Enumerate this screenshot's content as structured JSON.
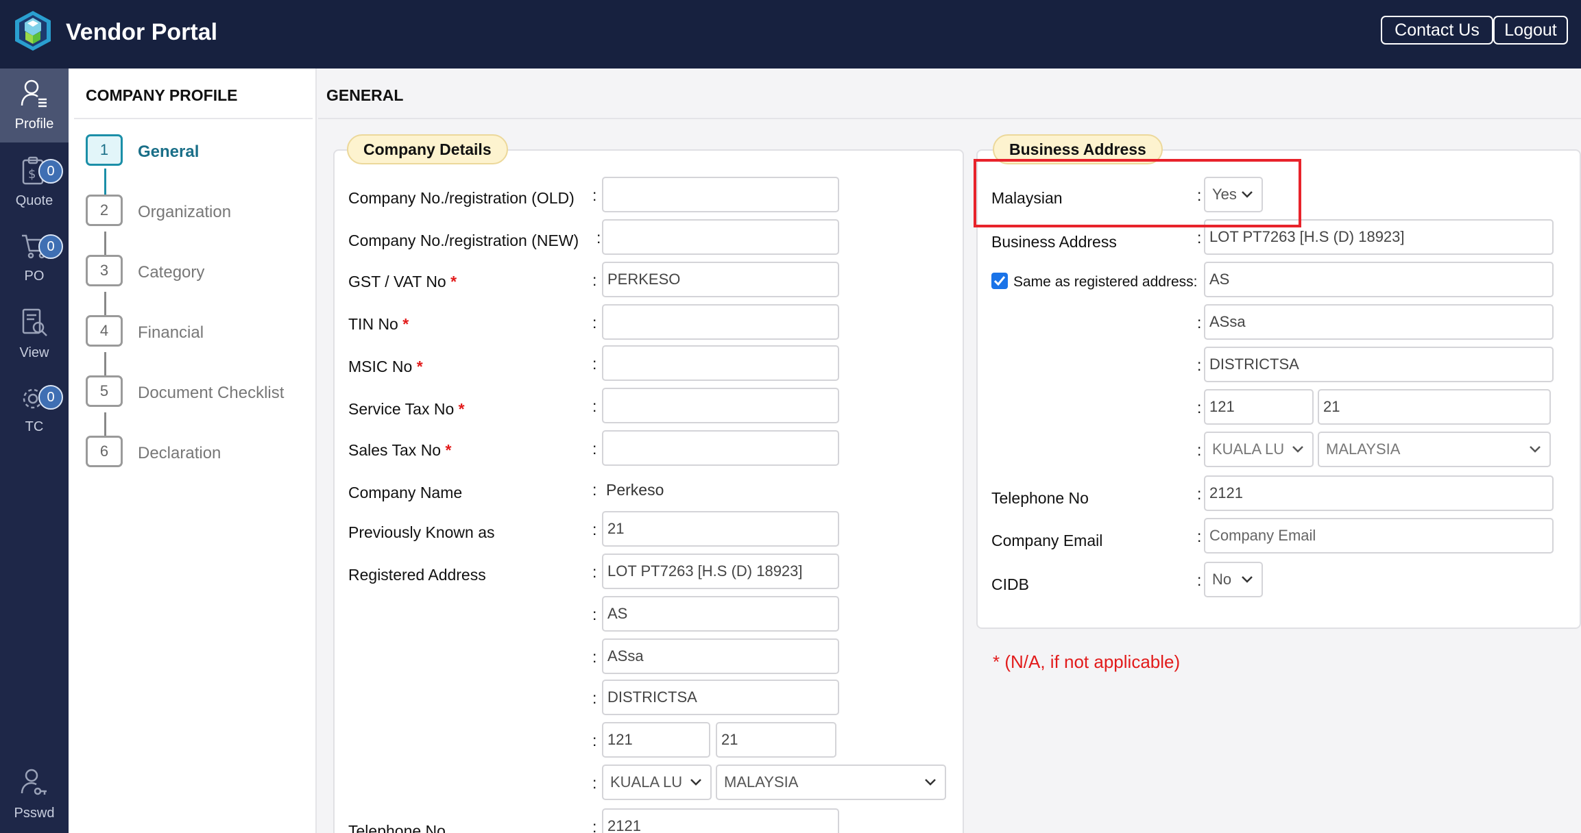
{
  "header": {
    "title": "Vendor Portal",
    "contact_label": "Contact Us",
    "logout_label": "Logout"
  },
  "rail": {
    "profile_label": "Profile",
    "quote_label": "Quote",
    "quote_badge": "0",
    "po_label": "PO",
    "po_badge": "0",
    "view_label": "View",
    "tc_label": "TC",
    "tc_badge": "0",
    "pssw_label": "Psswd"
  },
  "steps": {
    "title": "COMPANY PROFILE",
    "items": [
      {
        "num": "1",
        "label": "General"
      },
      {
        "num": "2",
        "label": "Organization"
      },
      {
        "num": "3",
        "label": "Category"
      },
      {
        "num": "4",
        "label": "Financial"
      },
      {
        "num": "5",
        "label": "Document Checklist"
      },
      {
        "num": "6",
        "label": "Declaration"
      }
    ]
  },
  "main": {
    "title": "GENERAL"
  },
  "company": {
    "heading": "Company Details",
    "reg_old_label": "Company No./registration (OLD)",
    "reg_old_value": "",
    "reg_new_label": "Company No./registration (NEW)",
    "reg_new_value": "",
    "gst_label": "GST / VAT No",
    "gst_value": "PERKESO",
    "tin_label": "TIN No",
    "tin_value": "",
    "msic_label": "MSIC No",
    "msic_value": "",
    "service_tax_label": "Service Tax No",
    "service_tax_value": "",
    "sales_tax_label": "Sales Tax No",
    "sales_tax_value": "",
    "company_name_label": "Company Name",
    "company_name_value": "Perkeso",
    "prev_known_label": "Previously Known as",
    "prev_known_value": "21",
    "reg_address_label": "Registered Address",
    "reg_address_line1": "LOT PT7263 [H.S (D) 18923]",
    "reg_address_line2": "AS",
    "reg_address_line3": "ASsa",
    "reg_address_line4": "DISTRICTSA",
    "reg_postcode": "121",
    "reg_postcode2": "21",
    "reg_city": "KUALA LU",
    "reg_country": "MALAYSIA",
    "telephone_label": "Telephone No",
    "telephone_value": "2121",
    "required_mark": "*",
    "colon": ":"
  },
  "business": {
    "heading": "Business Address",
    "malaysian_label": "Malaysian",
    "malaysian_value": "Yes",
    "address_label": "Business Address",
    "address_line1": "LOT PT7263 [H.S (D) 18923]",
    "same_as_label": "Same as registered address:",
    "same_as_checked": true,
    "address_line2": "AS",
    "address_line3": "ASsa",
    "address_line4": "DISTRICTSA",
    "postcode": "121",
    "postcode2": "21",
    "city": "KUALA LU",
    "country": "MALAYSIA",
    "telephone_label": "Telephone No",
    "telephone_value": "2121",
    "email_label": "Company Email",
    "email_placeholder": "Company Email",
    "cidb_label": "CIDB",
    "cidb_value": "No"
  },
  "note": "*  (N/A, if not applicable)",
  "colors": {
    "topbar": "#17213f",
    "rail": "#1e2748",
    "accent": "#1b8fa8",
    "required": "#e21b1b",
    "pill": "#fdf3cf"
  }
}
